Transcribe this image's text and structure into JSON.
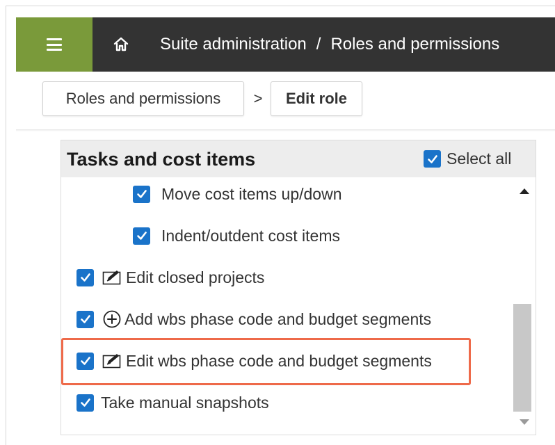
{
  "topbar": {
    "title_part1": "Suite administration",
    "separator": "/",
    "title_part2": "Roles and permissions",
    "menu_icon": "hamburger-menu-icon",
    "home_icon": "home-icon",
    "accent_color": "#7a9a3a",
    "bar_color": "#333333"
  },
  "breadcrumb": {
    "item1": "Roles and permissions",
    "arrow": ">",
    "item2": "Edit role"
  },
  "panel": {
    "title": "Tasks and cost items",
    "select_all_label": "Select all",
    "select_all_checked": true,
    "checkbox_color": "#1a73c9",
    "highlight_color": "#ee6a4a",
    "items": [
      {
        "label": "Move cost items up/down",
        "checked": true,
        "icon": ""
      },
      {
        "label": "Indent/outdent cost items",
        "checked": true,
        "icon": ""
      },
      {
        "label": "Edit closed projects",
        "checked": true,
        "icon": "edit-icon"
      },
      {
        "label": "Add wbs phase code and budget segments",
        "checked": true,
        "icon": "add-circle-icon"
      },
      {
        "label": "Edit wbs phase code and budget segments",
        "checked": true,
        "icon": "edit-icon"
      },
      {
        "label": "Take manual snapshots",
        "checked": true,
        "icon": ""
      }
    ]
  }
}
